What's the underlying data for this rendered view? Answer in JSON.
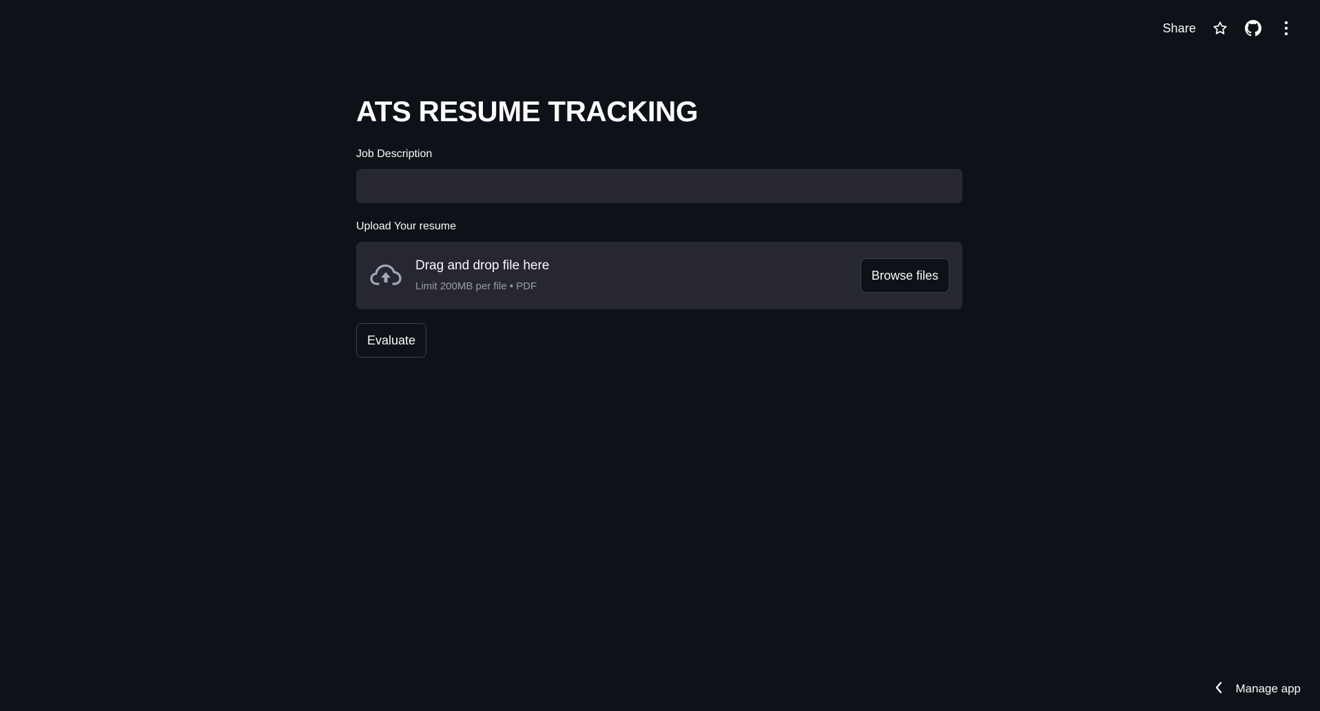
{
  "toolbar": {
    "share_label": "Share",
    "icons": [
      "star-icon",
      "github-icon",
      "more-vertical-icon"
    ]
  },
  "main": {
    "title": "ATS RESUME TRACKING",
    "job_description": {
      "label": "Job Description",
      "value": "",
      "placeholder": ""
    },
    "upload": {
      "label": "Upload Your resume",
      "dropzone_title": "Drag and drop file here",
      "dropzone_subtitle": "Limit 200MB per file • PDF",
      "browse_label": "Browse files",
      "icon": "cloud-upload-icon"
    },
    "evaluate_label": "Evaluate"
  },
  "footer": {
    "manage_app_label": "Manage app",
    "icon": "chevron-left-icon"
  },
  "colors": {
    "background": "#0e1117",
    "input_background": "#262730",
    "text": "#fafafa",
    "muted_text": "#9a9ca4",
    "button_border": "#3c3f4a"
  }
}
